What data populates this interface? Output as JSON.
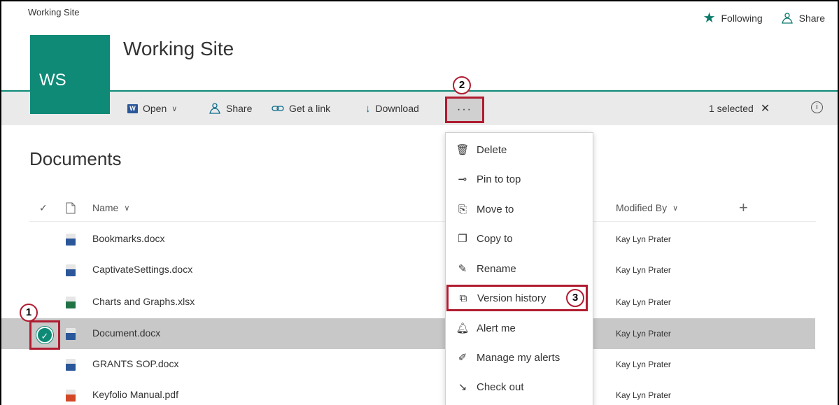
{
  "header": {
    "site_name_small": "Working Site",
    "site_title": "Working Site",
    "logo_initials": "WS",
    "following_label": "Following",
    "share_label": "Share"
  },
  "toolbar": {
    "open_label": "Open",
    "share_label": "Share",
    "get_link_label": "Get a link",
    "download_label": "Download",
    "more_label": "···",
    "selected_label": "1 selected",
    "close_glyph": "✕",
    "info_glyph": "i"
  },
  "page": {
    "title": "Documents",
    "columns": {
      "name": "Name",
      "modified_by": "Modified By"
    }
  },
  "files": [
    {
      "name": "Bookmarks.docx",
      "type": "docx",
      "modified_by": "Kay Lyn Prater",
      "selected": false
    },
    {
      "name": "CaptivateSettings.docx",
      "type": "docx",
      "modified_by": "Kay Lyn Prater",
      "selected": false
    },
    {
      "name": "Charts and Graphs.xlsx",
      "type": "xlsx",
      "modified_by": "Kay Lyn Prater",
      "selected": false
    },
    {
      "name": "Document.docx",
      "type": "docx",
      "modified_by": "Kay Lyn Prater",
      "selected": true
    },
    {
      "name": "GRANTS SOP.docx",
      "type": "docx",
      "modified_by": "Kay Lyn Prater",
      "selected": false
    },
    {
      "name": "Keyfolio Manual.pdf",
      "type": "pdf",
      "modified_by": "Kay Lyn Prater",
      "selected": false
    }
  ],
  "menu": {
    "items": [
      {
        "label": "Delete",
        "icon": "trash-icon"
      },
      {
        "label": "Pin to top",
        "icon": "pin-icon"
      },
      {
        "label": "Move to",
        "icon": "move-icon"
      },
      {
        "label": "Copy to",
        "icon": "copy-icon"
      },
      {
        "label": "Rename",
        "icon": "pencil-icon"
      },
      {
        "label": "Version history",
        "icon": "version-history-icon"
      },
      {
        "label": "Alert me",
        "icon": "bell-icon"
      },
      {
        "label": "Manage my alerts",
        "icon": "manage-alerts-icon"
      },
      {
        "label": "Check out",
        "icon": "check-out-icon"
      }
    ]
  },
  "callouts": [
    "1",
    "2",
    "3"
  ],
  "colors": {
    "accent": "#0e8a77",
    "callout_red": "#b01c30",
    "command_bar": "#eaeaea",
    "selected_row": "#c8c8c8"
  }
}
